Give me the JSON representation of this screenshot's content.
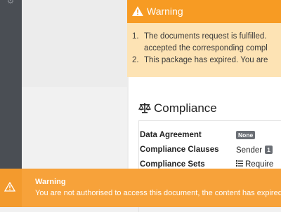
{
  "sidebar": {
    "top_icon": "gear-icon"
  },
  "warning_card": {
    "title": "Warning",
    "items": [
      {
        "num": "1.",
        "line1": "The documents request is fulfilled.",
        "line2": "accepted the corresponding compl"
      },
      {
        "num": "2.",
        "line1": "This package has expired. You are"
      }
    ]
  },
  "compliance": {
    "title": "Compliance",
    "rows": [
      {
        "label": "Data Agreement",
        "value_badge": "None"
      },
      {
        "label": "Compliance Clauses",
        "value": "Sender",
        "count": "1"
      },
      {
        "label": "Compliance Sets",
        "value": "Require"
      }
    ]
  },
  "toast": {
    "title": "Warning",
    "message": "You are not authorised to access this document, the content has expired"
  },
  "colors": {
    "warning_orange": "#f79b23",
    "warning_bg": "#fde3b4",
    "sidebar": "#4a4e54"
  }
}
